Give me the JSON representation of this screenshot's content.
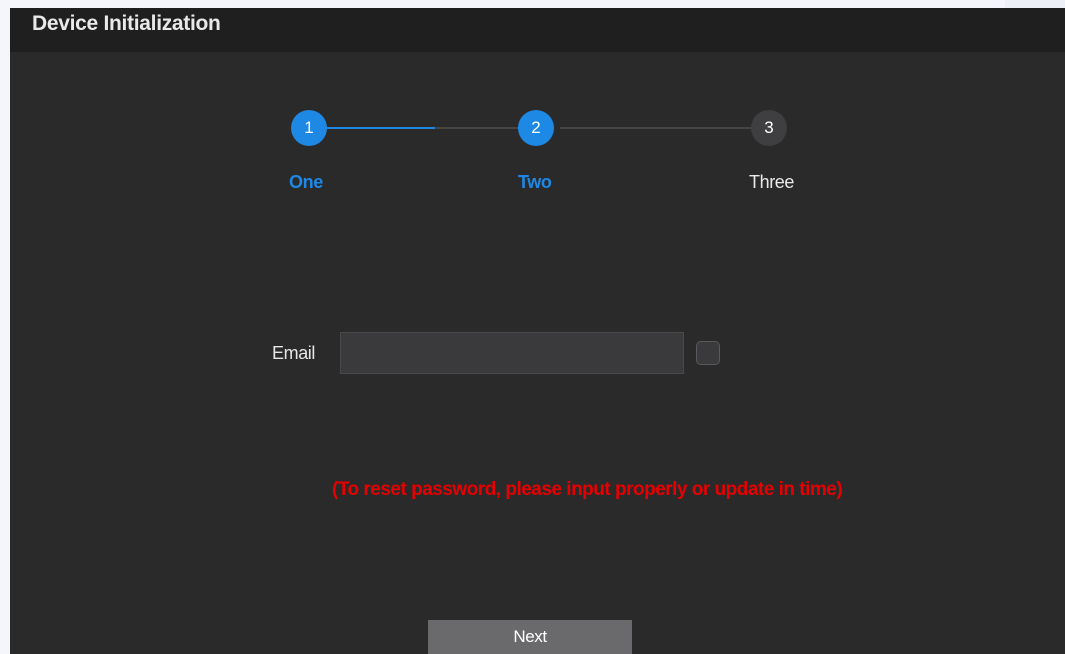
{
  "dialog": {
    "title": "Device Initialization"
  },
  "steps": [
    {
      "number": "1",
      "label": "One",
      "state": "completed"
    },
    {
      "number": "2",
      "label": "Two",
      "state": "active"
    },
    {
      "number": "3",
      "label": "Three",
      "state": "pending"
    }
  ],
  "form": {
    "email_label": "Email",
    "email_value": "",
    "email_placeholder": "",
    "email_checkbox_checked": false
  },
  "warning": "(To reset password, please input properly or update in time)",
  "buttons": {
    "next_label": "Next"
  },
  "colors": {
    "accent": "#1e88e5",
    "warning": "#e60000",
    "dialog_bg": "#2a2a2b",
    "title_bg": "#1f1f20"
  }
}
